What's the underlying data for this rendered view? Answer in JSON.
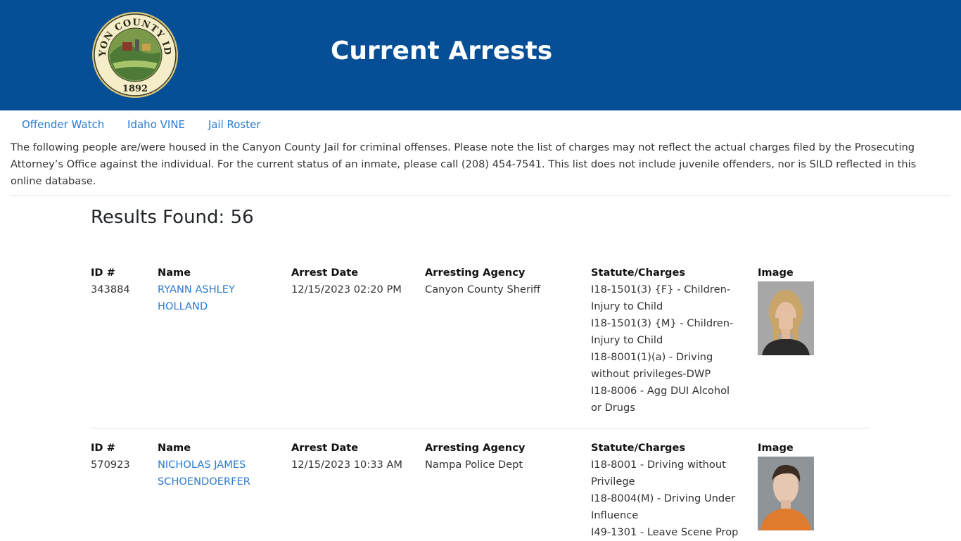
{
  "header": {
    "title": "Current Arrests",
    "seal_text_top": "CANYON COUNTY IDAHO",
    "seal_year": "1892"
  },
  "nav": {
    "items": [
      {
        "label": "Offender Watch"
      },
      {
        "label": "Idaho VINE"
      },
      {
        "label": "Jail Roster"
      }
    ]
  },
  "notice": "The following people are/were housed in the Canyon County Jail for criminal offenses. Please note the list of charges may not reflect the actual charges filed by the Prosecuting Attorney’s Office against the individual. For the current status of an inmate, please call (208) 454-7541. This list does not include juvenile offenders, nor is SILD reflected in this online database.",
  "results_label": "Results Found: 56",
  "columns": {
    "id": "ID #",
    "name": "Name",
    "date": "Arrest Date",
    "agency": "Arresting Agency",
    "charges": "Statute/Charges",
    "image": "Image"
  },
  "records": [
    {
      "id": "343884",
      "name_line1": "RYANN ASHLEY",
      "name_line2": "HOLLAND",
      "date": "12/15/2023 02:20 PM",
      "agency": "Canyon County Sheriff",
      "charges": [
        "I18-1501(3) {F} - Children-",
        "Injury to Child",
        "I18-1501(3) {M} - Children-",
        "Injury to Child",
        "I18-8001(1)(a) - Driving",
        "without privileges-DWP",
        "I18-8006 - Agg DUI Alcohol",
        "or Drugs"
      ]
    },
    {
      "id": "570923",
      "name_line1": "NICHOLAS JAMES",
      "name_line2": "SCHOENDOERFER",
      "date": "12/15/2023 10:33 AM",
      "agency": "Nampa Police Dept",
      "charges": [
        "I18-8001 - Driving without",
        "Privilege",
        "I18-8004(M) - Driving Under",
        "Influence",
        "I49-1301 - Leave Scene Prop"
      ]
    }
  ],
  "colors": {
    "header_bg": "#064f96",
    "link": "#2a7bd1"
  }
}
